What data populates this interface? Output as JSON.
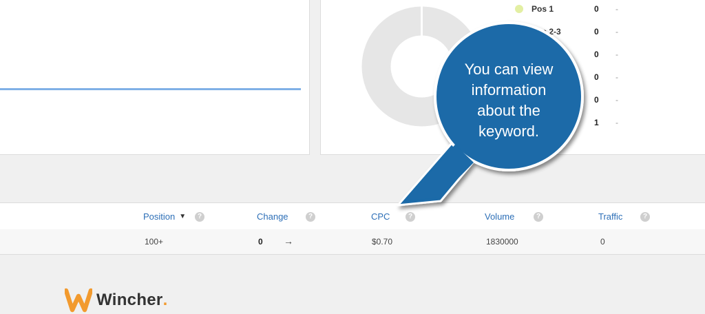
{
  "legend": [
    {
      "label": "Pos 1",
      "count": "0",
      "trend": "-"
    },
    {
      "label": "Pos 2-3",
      "count": "0",
      "trend": "-"
    },
    {
      "label": "",
      "count": "0",
      "trend": "-"
    },
    {
      "label": "",
      "count": "0",
      "trend": "-"
    },
    {
      "label": "",
      "count": "0",
      "trend": "-"
    },
    {
      "label": "",
      "count": "1",
      "trend": "-"
    }
  ],
  "legend_colors": [
    "#e3efa3",
    "#bde0a0"
  ],
  "table": {
    "headers": {
      "position": "Position",
      "change": "Change",
      "cpc": "CPC",
      "volume": "Volume",
      "traffic": "Traffic"
    },
    "help_glyph": "?",
    "sort_caret": "▼",
    "row": {
      "position": "100+",
      "change": "0",
      "change_arrow": "→",
      "cpc": "$0.70",
      "volume": "1830000",
      "traffic": "0"
    }
  },
  "callout": {
    "text_lines": [
      "You can view",
      "information",
      "about the",
      "keyword."
    ],
    "color": "#1a6aa8"
  },
  "brand": {
    "name": "Wincher",
    "dot": ".",
    "accent": "#f29a2e"
  }
}
